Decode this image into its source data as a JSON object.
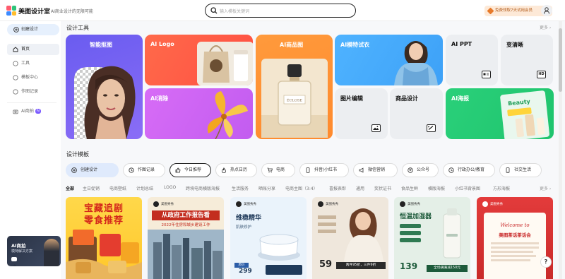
{
  "header": {
    "app_name": "美图设计室",
    "slogan": "AI商业设计的无限可能",
    "search_placeholder": "输入模板关键词",
    "vip_label": "免费领取7天试用会员"
  },
  "sidebar": {
    "create_label": "创建设计",
    "items": [
      {
        "label": "首页",
        "icon": "home-icon"
      },
      {
        "label": "工具",
        "icon": "tools-icon"
      },
      {
        "label": "模板中心",
        "icon": "template-icon"
      },
      {
        "label": "作图记录",
        "icon": "history-icon"
      }
    ],
    "ai_item": {
      "label": "AI商拍",
      "badge": "AI"
    },
    "promo": {
      "title": "AI商拍",
      "subtitle": "模特解决方案"
    }
  },
  "tools_section": {
    "title": "设计工具",
    "more": "更多",
    "cards": [
      {
        "label": "智能抠图"
      },
      {
        "label": "AI Logo"
      },
      {
        "label": "AI消除"
      },
      {
        "label": "AI商品图"
      },
      {
        "label": "AI模特试衣"
      },
      {
        "label": "AI PPT",
        "icon": "ppt-icon"
      },
      {
        "label": "变清晰",
        "icon": "hd-icon",
        "icon_text": "HD"
      },
      {
        "label": "图片编辑",
        "icon": "image-edit-icon"
      },
      {
        "label": "商品设计",
        "icon": "product-design-icon"
      },
      {
        "label": "AI海报"
      }
    ]
  },
  "templates_section": {
    "title": "设计模板",
    "more": "更多",
    "chips": [
      {
        "label": "创建设计"
      },
      {
        "label": "作图记录"
      },
      {
        "label": "今日推荐"
      },
      {
        "label": "热点日历"
      },
      {
        "label": "电商"
      },
      {
        "label": "抖音/小红书"
      },
      {
        "label": "微信营销"
      },
      {
        "label": "公众号"
      },
      {
        "label": "行政办公/教育"
      },
      {
        "label": "社交生活"
      }
    ],
    "categories": [
      "全部",
      "主日促销",
      "电商壁纸",
      "计划总结",
      "LOGO",
      "跨境电商横版海报",
      "生活服务",
      "晒账分享",
      "电商主图（3:4）",
      "喜报表彰",
      "通用",
      "奖状证书",
      "食品生鲜",
      "横版海报",
      "小红书背景图",
      "方形海报"
    ]
  },
  "template_cards": [
    {
      "title": "宝藏追剧",
      "title2": "零食推荐"
    },
    {
      "brand": "美图秀秀",
      "title": "从政府工作报告看",
      "subtitle": "2022年住房和城乡建设工作"
    },
    {
      "brand": "美图秀秀",
      "title": "维稳精华",
      "subtitle": "肌肤修护",
      "price": "299",
      "price_label": "原价"
    },
    {
      "brand": "美图秀秀",
      "price": "59",
      "promo": "两件95折，三件9折"
    },
    {
      "brand": "美图秀秀",
      "title": "恒温加湿器",
      "price": "139",
      "promo": "全场满满减150元"
    },
    {
      "brand": "美图秀秀",
      "title": "Welcome to",
      "subtitle": "美图茶话茶话会"
    }
  ],
  "help_label": "?"
}
